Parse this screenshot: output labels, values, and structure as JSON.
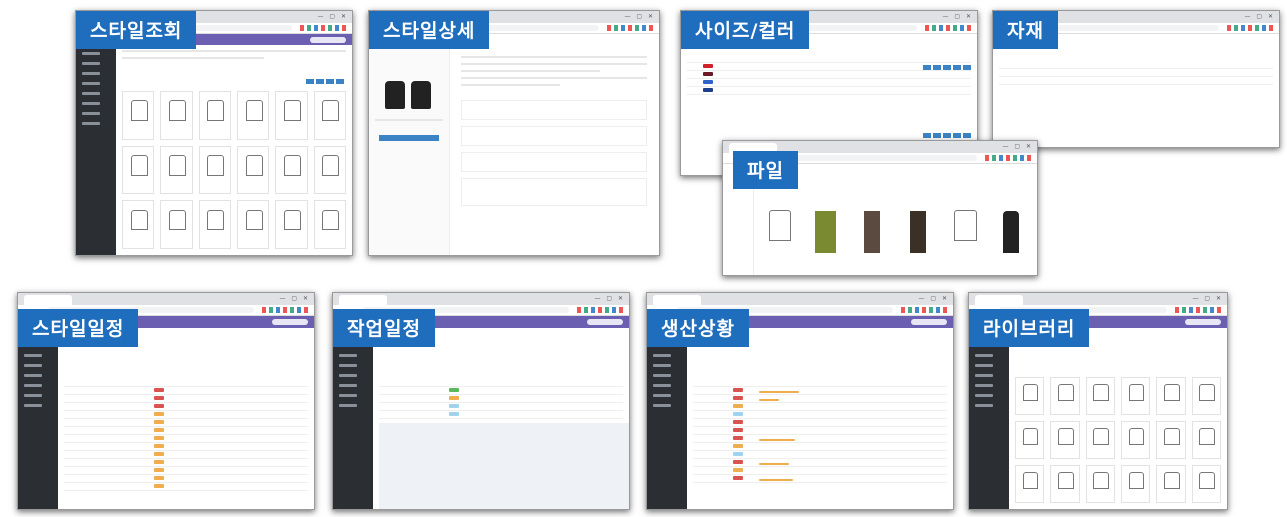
{
  "panels": {
    "style_list": {
      "label": "스타일조회"
    },
    "style_detail": {
      "label": "스타일상세"
    },
    "size_color": {
      "label": "사이즈/컬러"
    },
    "material": {
      "label": "자재"
    },
    "file": {
      "label": "파일"
    },
    "style_schedule": {
      "label": "스타일일정"
    },
    "work_schedule": {
      "label": "작업일정"
    },
    "production_status": {
      "label": "생산상황"
    },
    "library": {
      "label": "라이브러리"
    }
  },
  "colors": {
    "label_bg": "#1f6dbd",
    "header_purple": "#6a5fb0",
    "sidebar": "#2b2f33",
    "accent_button": "#3b83c4"
  }
}
